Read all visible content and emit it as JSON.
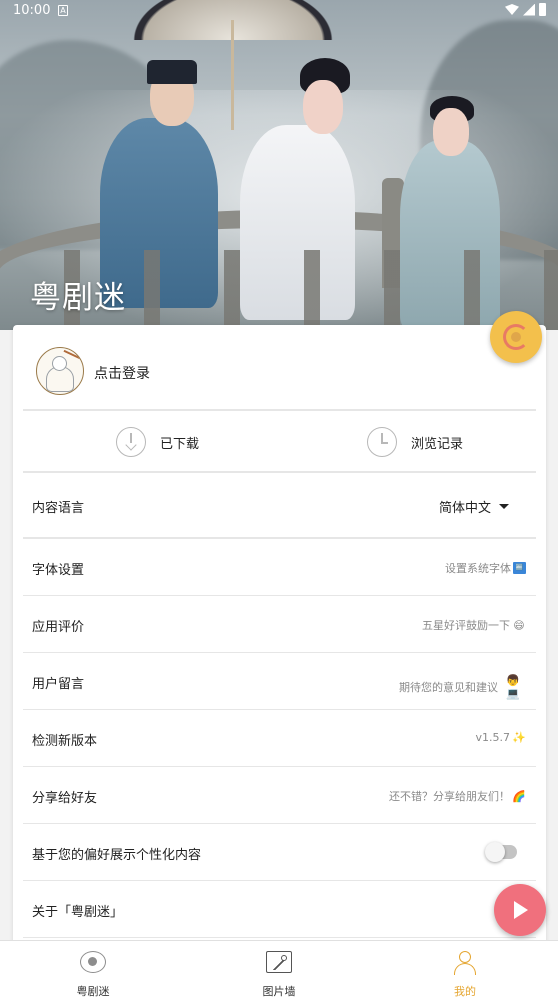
{
  "status_bar": {
    "time": "10:00",
    "notification_icon": "A"
  },
  "header": {
    "title": "粤剧迷"
  },
  "login": {
    "label": "点击登录"
  },
  "quick_actions": [
    {
      "label": "已下载",
      "icon": "download-clock-icon"
    },
    {
      "label": "浏览记录",
      "icon": "history-clock-icon"
    }
  ],
  "language": {
    "label": "内容语言",
    "value": "简体中文"
  },
  "menu": [
    {
      "title": "字体设置",
      "hint": "设置系统字体",
      "trailing": "🔤"
    },
    {
      "title": "应用评价",
      "hint": "五星好评鼓励一下",
      "trailing": "😄"
    },
    {
      "title": "用户留言",
      "hint": "期待您的意见和建议",
      "trailing": "👦💻"
    },
    {
      "title": "检测新版本",
      "hint": "v1.5.7",
      "trailing": "✨"
    },
    {
      "title": "分享给好友",
      "hint": "还不错？分享给朋友们！",
      "trailing": "🌈"
    },
    {
      "title": "基于您的偏好展示个性化内容",
      "toggle": "off"
    },
    {
      "title": "关于「粤剧迷」"
    }
  ],
  "bottom_nav": [
    {
      "label": "粤剧迷",
      "icon": "opera-icon"
    },
    {
      "label": "图片墙",
      "icon": "image-icon"
    },
    {
      "label": "我的",
      "icon": "person-icon",
      "active": true
    }
  ],
  "colors": {
    "accent": "#e5a631",
    "fab_orange": "#f3c04c",
    "fab_red": "#f0707d"
  }
}
